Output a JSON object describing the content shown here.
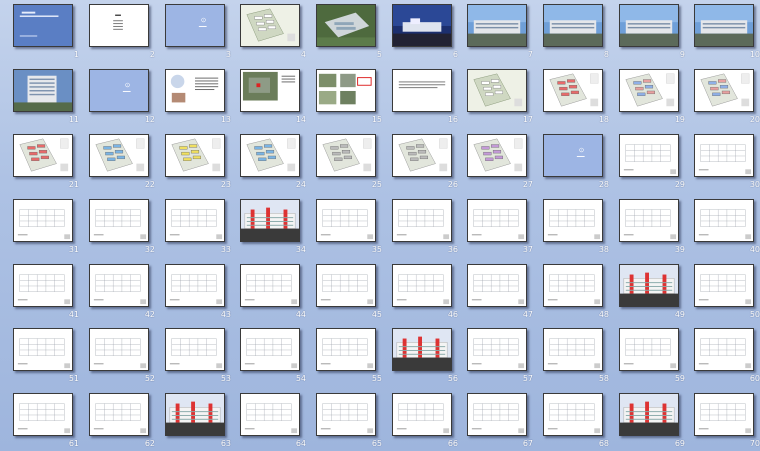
{
  "window": {
    "title": ""
  },
  "theme": {
    "background": "#aec2e4",
    "slide_border": "#3a3a3a",
    "number_color": "#ffffff"
  },
  "slides": [
    {
      "number": "1",
      "type": "title"
    },
    {
      "number": "2",
      "type": "toc"
    },
    {
      "number": "3",
      "type": "blue-logo"
    },
    {
      "number": "4",
      "type": "site-plan"
    },
    {
      "number": "5",
      "type": "aerial"
    },
    {
      "number": "6",
      "type": "photo-night"
    },
    {
      "number": "7",
      "type": "photo-day"
    },
    {
      "number": "8",
      "type": "photo-day"
    },
    {
      "number": "9",
      "type": "photo-day"
    },
    {
      "number": "10",
      "type": "photo-day"
    },
    {
      "number": "11",
      "type": "photo-tower"
    },
    {
      "number": "12",
      "type": "blue-logo"
    },
    {
      "number": "13",
      "type": "text-images"
    },
    {
      "number": "14",
      "type": "aerial-map"
    },
    {
      "number": "15",
      "type": "photos-red"
    },
    {
      "number": "16",
      "type": "text"
    },
    {
      "number": "17",
      "type": "site-plan"
    },
    {
      "number": "18",
      "type": "site-plan-red"
    },
    {
      "number": "19",
      "type": "site-plan-multi"
    },
    {
      "number": "20",
      "type": "site-plan-multi"
    },
    {
      "number": "21",
      "type": "site-plan-red"
    },
    {
      "number": "22",
      "type": "site-plan-blue"
    },
    {
      "number": "23",
      "type": "site-plan-yellow"
    },
    {
      "number": "24",
      "type": "site-plan-blue"
    },
    {
      "number": "25",
      "type": "site-plan-gray"
    },
    {
      "number": "26",
      "type": "site-plan-gray"
    },
    {
      "number": "27",
      "type": "site-plan-purple"
    },
    {
      "number": "28",
      "type": "blue-logo"
    },
    {
      "number": "29",
      "type": "drawing"
    },
    {
      "number": "30",
      "type": "drawing"
    },
    {
      "number": "31",
      "type": "drawing"
    },
    {
      "number": "32",
      "type": "drawing"
    },
    {
      "number": "33",
      "type": "drawing"
    },
    {
      "number": "34",
      "type": "elevation"
    },
    {
      "number": "35",
      "type": "drawing"
    },
    {
      "number": "36",
      "type": "drawing"
    },
    {
      "number": "37",
      "type": "drawing"
    },
    {
      "number": "38",
      "type": "drawing"
    },
    {
      "number": "39",
      "type": "drawing"
    },
    {
      "number": "40",
      "type": "drawing"
    },
    {
      "number": "41",
      "type": "drawing"
    },
    {
      "number": "42",
      "type": "drawing"
    },
    {
      "number": "43",
      "type": "drawing"
    },
    {
      "number": "44",
      "type": "drawing"
    },
    {
      "number": "45",
      "type": "drawing"
    },
    {
      "number": "46",
      "type": "drawing"
    },
    {
      "number": "47",
      "type": "drawing"
    },
    {
      "number": "48",
      "type": "drawing"
    },
    {
      "number": "49",
      "type": "elevation"
    },
    {
      "number": "50",
      "type": "drawing"
    },
    {
      "number": "51",
      "type": "drawing"
    },
    {
      "number": "52",
      "type": "drawing"
    },
    {
      "number": "53",
      "type": "drawing"
    },
    {
      "number": "54",
      "type": "drawing"
    },
    {
      "number": "55",
      "type": "drawing"
    },
    {
      "number": "56",
      "type": "elevation"
    },
    {
      "number": "57",
      "type": "drawing"
    },
    {
      "number": "58",
      "type": "drawing"
    },
    {
      "number": "59",
      "type": "drawing"
    },
    {
      "number": "60",
      "type": "drawing"
    },
    {
      "number": "61",
      "type": "drawing"
    },
    {
      "number": "62",
      "type": "drawing"
    },
    {
      "number": "63",
      "type": "elevation"
    },
    {
      "number": "64",
      "type": "drawing"
    },
    {
      "number": "65",
      "type": "drawing"
    },
    {
      "number": "66",
      "type": "drawing"
    },
    {
      "number": "67",
      "type": "drawing"
    },
    {
      "number": "68",
      "type": "drawing"
    },
    {
      "number": "69",
      "type": "elevation"
    },
    {
      "number": "70",
      "type": "drawing"
    }
  ]
}
